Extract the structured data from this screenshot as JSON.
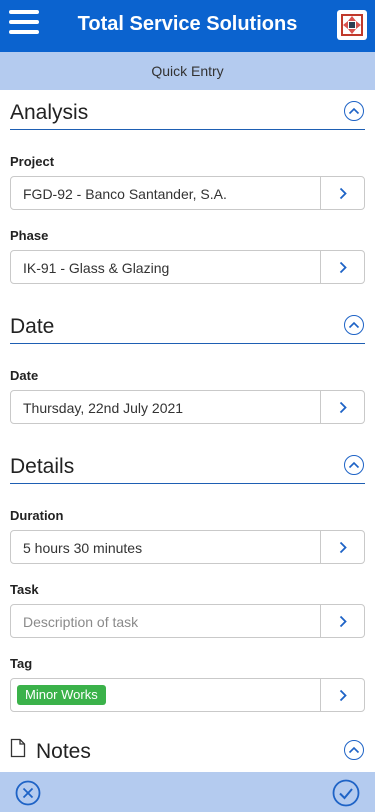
{
  "header": {
    "title": "Total Service Solutions",
    "menu_icon": "hamburger-icon",
    "logo_icon": "company-logo"
  },
  "subheader": {
    "label": "Quick Entry"
  },
  "sections": {
    "analysis": {
      "title": "Analysis"
    },
    "date": {
      "title": "Date"
    },
    "details": {
      "title": "Details"
    },
    "notes": {
      "title": "Notes"
    }
  },
  "fields": {
    "project": {
      "label": "Project",
      "value": "FGD-92 - Banco Santander, S.A."
    },
    "phase": {
      "label": "Phase",
      "value": "IK-91 - Glass & Glazing"
    },
    "date": {
      "label": "Date",
      "value": "Thursday, 22nd July 2021"
    },
    "duration": {
      "label": "Duration",
      "value": "5 hours 30 minutes"
    },
    "task": {
      "label": "Task",
      "placeholder": "Description of task"
    },
    "tag": {
      "label": "Tag",
      "value": "Minor Works",
      "color": "#3bb24a"
    }
  },
  "footer": {
    "cancel_icon": "cancel-circle-icon",
    "confirm_icon": "check-circle-icon"
  },
  "colors": {
    "primary": "#0b63cf",
    "subheader": "#b4cbef",
    "accent": "#1e63c6"
  }
}
